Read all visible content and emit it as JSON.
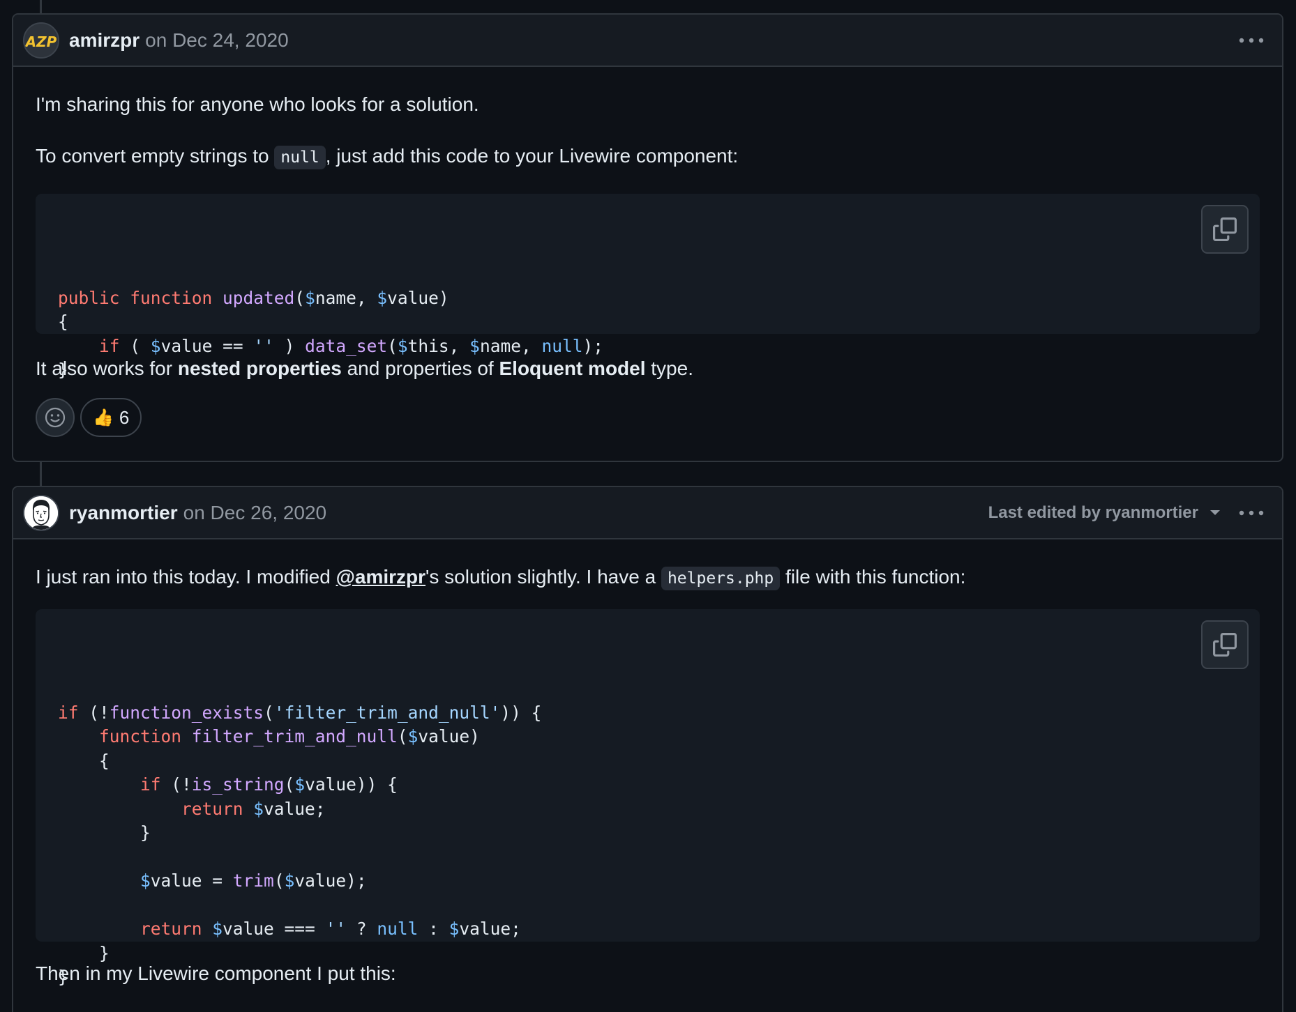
{
  "comments": [
    {
      "author": "amirzpr",
      "date": "on Dec 24, 2020",
      "avatar_text": "AZP",
      "paragraphs": {
        "p1": "I'm sharing this for anyone who looks for a solution.",
        "p2_before": "To convert empty strings to ",
        "p2_code": "null",
        "p2_after": ", just add this code to your Livewire component:",
        "p3_before": "It also works for ",
        "p3_bold1": "nested properties",
        "p3_mid": " and properties of ",
        "p3_bold2": "Eloquent model",
        "p3_after": " type."
      },
      "reaction": {
        "emoji": "👍",
        "count": "6"
      }
    },
    {
      "author": "ryanmortier",
      "date": "on Dec 26, 2020",
      "edited_label": "Last edited by ryanmortier",
      "paragraphs": {
        "p1_before": "I just ran into this today. I modified ",
        "p1_mention": "@amirzpr",
        "p1_mid": "'s solution slightly. I have a ",
        "p1_code": "helpers.php",
        "p1_after": " file with this function:",
        "p2": "Then in my Livewire component I put this:"
      }
    }
  ],
  "code_blocks": [
    {
      "lines": [
        [
          [
            "kw",
            "public "
          ],
          [
            "kw",
            "function "
          ],
          [
            "fn",
            "updated"
          ],
          [
            "",
            "("
          ],
          [
            "var",
            "$"
          ],
          [
            "",
            "name, "
          ],
          [
            "var",
            "$"
          ],
          [
            "",
            "value)"
          ]
        ],
        [
          [
            "",
            "{"
          ]
        ],
        [
          [
            "",
            "    "
          ],
          [
            "kw",
            "if"
          ],
          [
            "",
            " ( "
          ],
          [
            "var",
            "$"
          ],
          [
            "",
            "value == "
          ],
          [
            "str",
            "''"
          ],
          [
            "",
            " ) "
          ],
          [
            "fn",
            "data_set"
          ],
          [
            "",
            "("
          ],
          [
            "var",
            "$"
          ],
          [
            "",
            "this, "
          ],
          [
            "var",
            "$"
          ],
          [
            "",
            "name, "
          ],
          [
            "var",
            "null"
          ],
          [
            "",
            ");"
          ]
        ],
        [
          [
            "",
            "}"
          ]
        ]
      ]
    },
    {
      "lines": [
        [
          [
            "kw",
            "if"
          ],
          [
            "",
            " (!"
          ],
          [
            "fn",
            "function_exists"
          ],
          [
            "",
            "("
          ],
          [
            "str",
            "'filter_trim_and_null'"
          ],
          [
            "",
            ")) {"
          ]
        ],
        [
          [
            "",
            "    "
          ],
          [
            "kw",
            "function "
          ],
          [
            "fn",
            "filter_trim_and_null"
          ],
          [
            "",
            "("
          ],
          [
            "var",
            "$"
          ],
          [
            "",
            "value)"
          ]
        ],
        [
          [
            "",
            "    {"
          ]
        ],
        [
          [
            "",
            "        "
          ],
          [
            "kw",
            "if"
          ],
          [
            "",
            " (!"
          ],
          [
            "fn",
            "is_string"
          ],
          [
            "",
            "("
          ],
          [
            "var",
            "$"
          ],
          [
            "",
            "value)) {"
          ]
        ],
        [
          [
            "",
            "            "
          ],
          [
            "kw",
            "return "
          ],
          [
            "var",
            "$"
          ],
          [
            "",
            "value;"
          ]
        ],
        [
          [
            "",
            "        }"
          ]
        ],
        [
          [
            "",
            ""
          ]
        ],
        [
          [
            "",
            "        "
          ],
          [
            "var",
            "$"
          ],
          [
            "",
            "value = "
          ],
          [
            "fn",
            "trim"
          ],
          [
            "",
            "("
          ],
          [
            "var",
            "$"
          ],
          [
            "",
            "value);"
          ]
        ],
        [
          [
            "",
            ""
          ]
        ],
        [
          [
            "",
            "        "
          ],
          [
            "kw",
            "return "
          ],
          [
            "var",
            "$"
          ],
          [
            "",
            "value === "
          ],
          [
            "str",
            "''"
          ],
          [
            "",
            " ? "
          ],
          [
            "var",
            "null"
          ],
          [
            "",
            " : "
          ],
          [
            "var",
            "$"
          ],
          [
            "",
            "value;"
          ]
        ],
        [
          [
            "",
            "    }"
          ]
        ],
        [
          [
            "",
            "}"
          ]
        ]
      ]
    }
  ],
  "colors": {
    "background": "#0d1117",
    "header_bg": "#161b22",
    "border": "#30363d",
    "keyword": "#ff7b72",
    "function": "#d2a8ff",
    "variable": "#79c0ff",
    "string": "#a5d6ff"
  },
  "icons": [
    "kebab-icon",
    "copy-icon",
    "smiley-icon",
    "caret-down-icon"
  ]
}
